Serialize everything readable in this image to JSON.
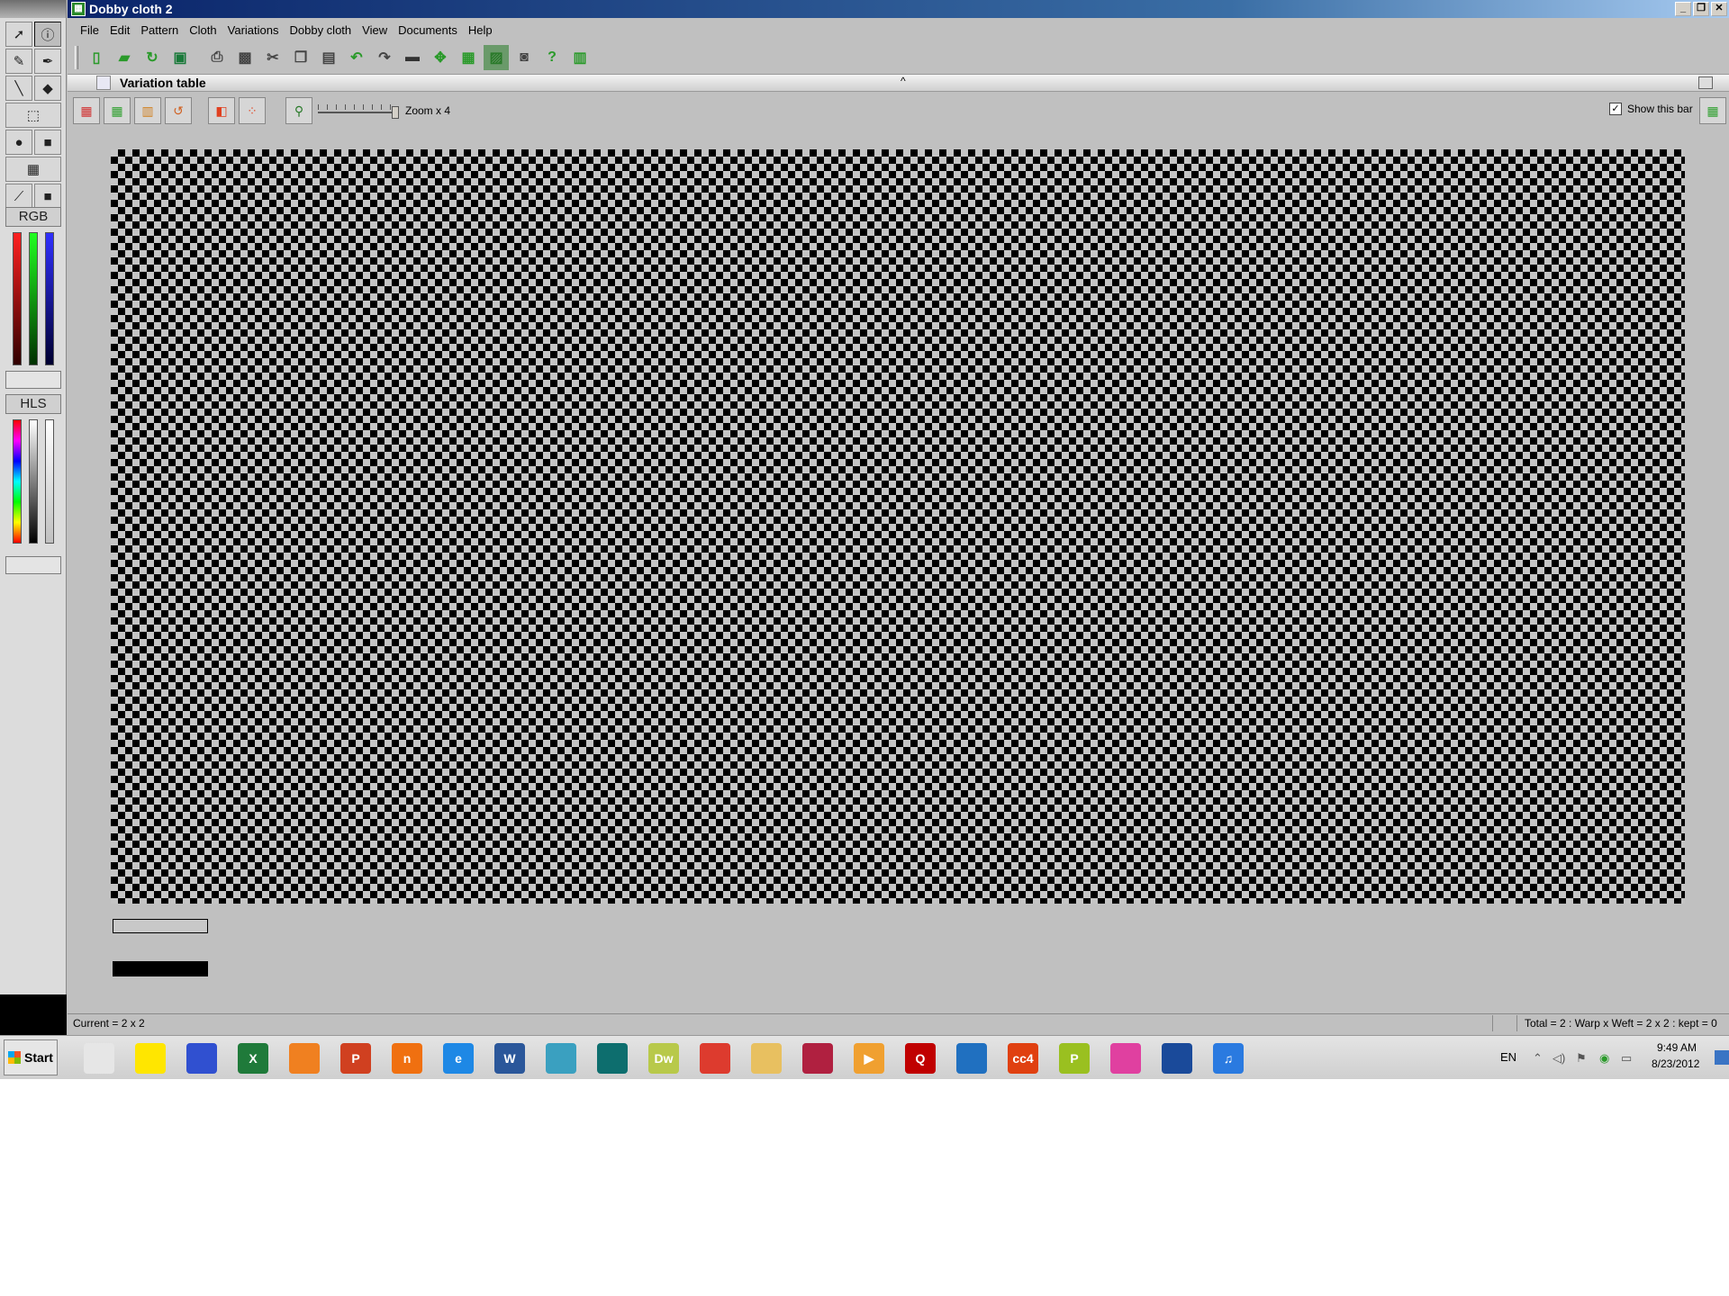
{
  "window": {
    "title": "Dobby cloth 2",
    "controls": [
      "_",
      "❐",
      "✕"
    ]
  },
  "menu": [
    "File",
    "Edit",
    "Pattern",
    "Cloth",
    "Variations",
    "Dobby cloth",
    "View",
    "Documents",
    "Help"
  ],
  "toolbar_icons": [
    "new-file-icon",
    "open-folder-icon",
    "refresh-icon",
    "save-icon",
    "print-icon",
    "printer-setup-icon",
    "cut-icon",
    "copy-icon",
    "paste-icon",
    "undo-icon",
    "redo-icon",
    "rectangle-icon",
    "puzzle-icon",
    "grid-icon",
    "weave-icon",
    "camera-icon",
    "help-icon",
    "book-icon"
  ],
  "palette": {
    "rgb_label": "RGB",
    "hls_label": "HLS",
    "rgb_colors": [
      "#d00000",
      "#00a000",
      "#0000d0"
    ],
    "current_color": "#000000"
  },
  "panel": {
    "title": "Variation table",
    "zoom_label": "Zoom x 4",
    "show_bar_label": "Show this bar",
    "show_bar_checked": true
  },
  "status": {
    "left": "Current = 2 x 2",
    "right": "Total = 2 : Warp x Weft = 2 x 2 : kept = 0"
  },
  "taskbar": {
    "start_label": "Start",
    "apps": [
      {
        "name": "explorer-window-icon",
        "text": "",
        "color": "#e6e6e6"
      },
      {
        "name": "weave-app-yellow-icon",
        "text": "",
        "color": "#ffe600"
      },
      {
        "name": "weave-app-blue-icon",
        "text": "",
        "color": "#3050d0"
      },
      {
        "name": "excel-icon",
        "text": "X",
        "color": "#1f7a3a"
      },
      {
        "name": "fruit-app-icon",
        "text": "",
        "color": "#f08020"
      },
      {
        "name": "powerpoint-icon",
        "text": "P",
        "color": "#d04020"
      },
      {
        "name": "orange-n-icon",
        "text": "n",
        "color": "#f07010"
      },
      {
        "name": "internet-explorer-icon",
        "text": "e",
        "color": "#1e88e5"
      },
      {
        "name": "word-icon",
        "text": "W",
        "color": "#2b579a"
      },
      {
        "name": "pattern-app-icon",
        "text": "",
        "color": "#3aa0c0"
      },
      {
        "name": "publisher-icon",
        "text": "",
        "color": "#0d6e6e"
      },
      {
        "name": "dreamweaver-icon",
        "text": "Dw",
        "color": "#b8c94a"
      },
      {
        "name": "chrome-icon",
        "text": "",
        "color": "#dd3b2e"
      },
      {
        "name": "file-manager-icon",
        "text": "",
        "color": "#e8c060"
      },
      {
        "name": "acrobat-icon",
        "text": "",
        "color": "#b02040"
      },
      {
        "name": "media-player-icon",
        "text": "▶",
        "color": "#f0a030"
      },
      {
        "name": "quicktime-q-icon",
        "text": "Q",
        "color": "#c00000"
      },
      {
        "name": "fiberworks-icon",
        "text": "",
        "color": "#2070c0"
      },
      {
        "name": "cc4-icon",
        "text": "cc4",
        "color": "#e04010"
      },
      {
        "name": "p-app-icon",
        "text": "P",
        "color": "#9ac020"
      },
      {
        "name": "pinwheel-icon",
        "text": "",
        "color": "#e040a0"
      },
      {
        "name": "blue-square-app-icon",
        "text": "",
        "color": "#1a4a9a"
      },
      {
        "name": "itunes-icon",
        "text": "♫",
        "color": "#2a7ae0"
      }
    ],
    "tray": {
      "language": "EN",
      "time": "9:49 AM",
      "date": "8/23/2012"
    }
  }
}
